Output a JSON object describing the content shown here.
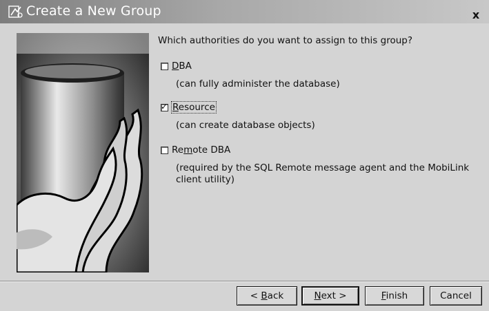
{
  "window": {
    "title": "Create a New Group",
    "close_label": "x",
    "icon": "app-wizard-icon"
  },
  "main": {
    "prompt": "Which authorities do you want to assign to this group?",
    "options": [
      {
        "label_before": "",
        "mnemonic": "D",
        "label_after": "BA",
        "checked": false,
        "description": "(can fully administer the database)"
      },
      {
        "label_before": "",
        "mnemonic": "R",
        "label_after": "esource",
        "checked": true,
        "description": "(can create database objects)"
      },
      {
        "label_before": "Re",
        "mnemonic": "m",
        "label_after": "ote DBA",
        "checked": false,
        "description_line1": "(required by the SQL Remote message agent and the MobiLink",
        "description_line2": "client utility)"
      }
    ]
  },
  "buttons": {
    "back": {
      "before": "< ",
      "mnemonic": "B",
      "after": "ack"
    },
    "next": {
      "before": "",
      "mnemonic": "N",
      "after": "ext >"
    },
    "finish": {
      "before": "",
      "mnemonic": "F",
      "after": "inish"
    },
    "cancel": "Cancel"
  },
  "colors": {
    "titlebar_start": "#7d7d7d",
    "titlebar_end": "#c8c8c8",
    "dialog_bg": "#d4d4d4"
  }
}
